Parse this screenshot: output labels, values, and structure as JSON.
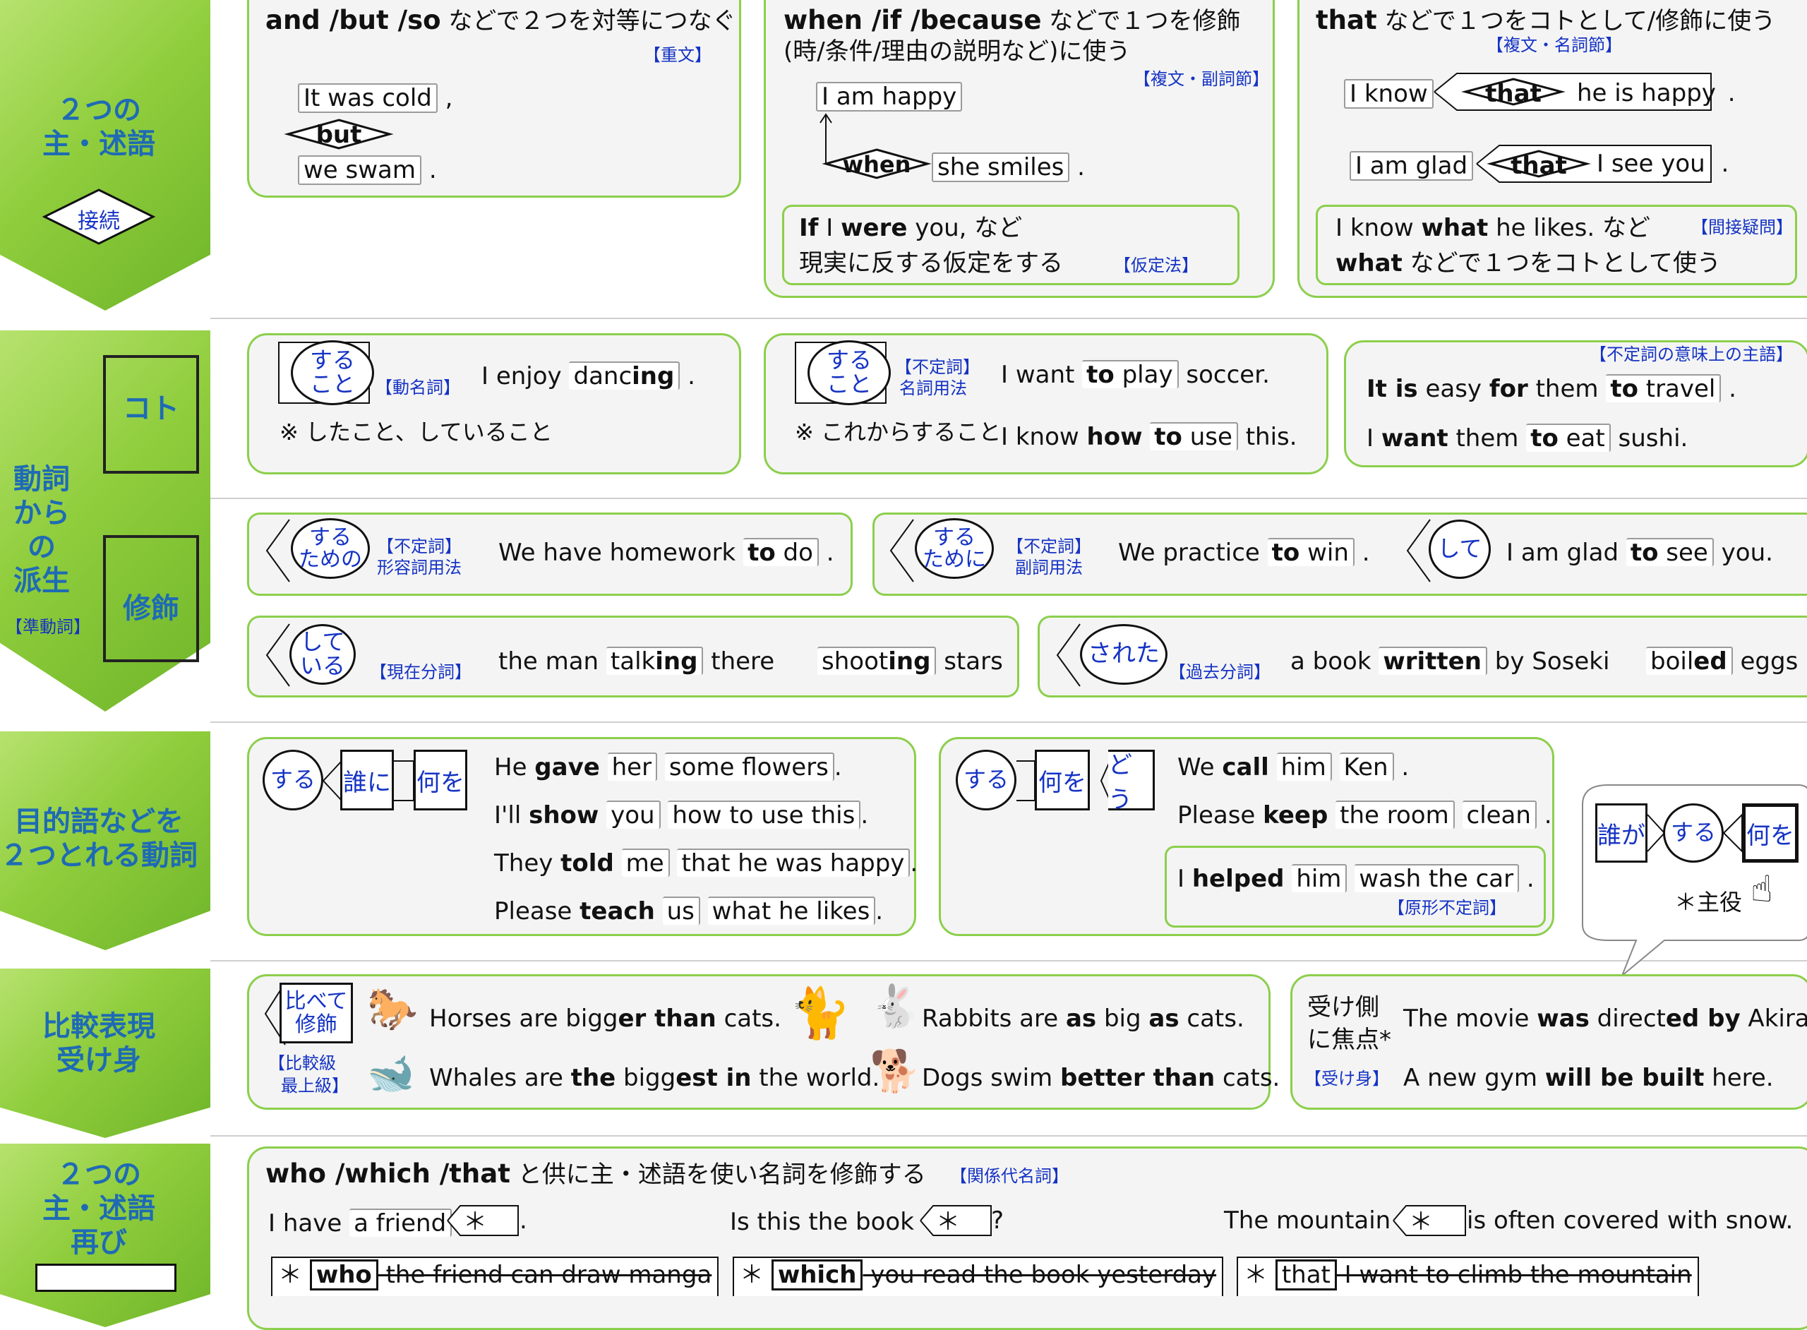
{
  "side": {
    "s1": {
      "line1": "２つの",
      "line2": "主・述語",
      "tag": "接続"
    },
    "s2": {
      "line1": "動詞",
      "line2": "からの",
      "line3": "派生",
      "tag": "【準動詞】",
      "koto": "コト",
      "shushoku": "修飾"
    },
    "s3": {
      "line1": "目的語などを",
      "line2": "２つとれる動詞"
    },
    "s4": {
      "line1": "比較表現",
      "line2": "受け身"
    },
    "s5": {
      "line1": "２つの",
      "line2": "主・述語",
      "line3": "再び"
    }
  },
  "r1": {
    "a": {
      "head_b": "and /but /so",
      "head_t": " などで２つを対等につなぐ",
      "tag": "【重文】",
      "l1": "It was cold",
      "l1_end": " ,",
      "conj": "but",
      "l2": "we swam",
      "l2_end": " ."
    },
    "b": {
      "head_b": "when /if /because",
      "head_t": " などで１つを修飾",
      "head2": "(時/条件/理由の説明など)に使う",
      "tag": "【複文・副詞節】",
      "main": "I am happy",
      "conj": "when",
      "sub": "she smiles",
      "sub_end": " .",
      "inner_b1": "If",
      "inner_t1": " I ",
      "inner_b2": "were",
      "inner_t2": " you, など",
      "inner_l2": "現実に反する仮定をする",
      "inner_tag": "【仮定法】"
    },
    "c": {
      "head_b": "that",
      "head_t": " などで１つをコトとして/修飾に使う",
      "tag": "【複文・名詞節】",
      "l1a": "I know",
      "l1k": "that",
      "l1b": "he is happy",
      "l1_end": " .",
      "l2a": "I am glad",
      "l2k": "that",
      "l2b": "I see you",
      "l2_end": " .",
      "inner_t1": "I know ",
      "inner_b1": "what",
      "inner_t2": " he likes. など",
      "inner_tag": "【間接疑問】",
      "inner_b2": "what",
      "inner_t3": " などで１つをコトとして使う"
    }
  },
  "r2": {
    "a": {
      "circ": "する\nこと",
      "tag": "【動名詞】",
      "s_pre": "I enjoy ",
      "s_w1": "danc",
      "s_w2": "ing",
      "s_end": " .",
      "note": "※ したこと、していること"
    },
    "b": {
      "circ": "する\nこと",
      "tag1": "【不定詞】",
      "tag2": "名詞用法",
      "s1_pre": "I want ",
      "s1_b": "to",
      "s1_w": " play",
      "s1_end": " soccer.",
      "note": "※ これからすること",
      "s2_pre": "I know ",
      "s2_b1": "how",
      "s2_b2": "to",
      "s2_w": " use",
      "s2_end": " this."
    },
    "c": {
      "tag": "【不定詞の意味上の主語】",
      "l1_b1": "It is",
      "l1_t1": " easy ",
      "l1_b2": "for",
      "l1_t2": " them ",
      "l1_b3": "to",
      "l1_w": " travel",
      "l1_end": " .",
      "l2_t1": "I ",
      "l2_b1": "want",
      "l2_t2": " them ",
      "l2_b2": "to",
      "l2_w": " eat",
      "l2_end": " sushi."
    }
  },
  "r3": {
    "a": {
      "circ": "する\nための",
      "tag1": "【不定詞】",
      "tag2": "形容詞用法",
      "s_pre": "We have homework ",
      "s_b": "to",
      "s_w": " do",
      "s_end": " ."
    },
    "b": {
      "circ": "する\nために",
      "tag1": "【不定詞】",
      "tag2": "副詞用法",
      "s_pre": "We practice ",
      "s_b": "to",
      "s_w": " win",
      "s_end": " .",
      "circ2": "して",
      "s2_pre": "I am glad ",
      "s2_b": "to",
      "s2_w": " see",
      "s2_end": " you."
    }
  },
  "r4": {
    "a": {
      "circ": "して\nいる",
      "tag": "【現在分詞】",
      "s_pre": "the man ",
      "s_w1": "talk",
      "s_w2": "ing",
      "s_end": " there",
      "s2_w1": "shoot",
      "s2_w2": "ing",
      "s2_end": " stars"
    },
    "b": {
      "circ": "された",
      "tag": "【過去分詞】",
      "s_pre": "a book ",
      "s_w": "written",
      "s_end": " by Soseki",
      "s2_w1": "boil",
      "s2_w2": "ed",
      "s2_end": " eggs"
    }
  },
  "r5": {
    "a": {
      "circ": "する",
      "sq1": "誰に",
      "sq2": "何を",
      "l1_t1": "He ",
      "l1_b": "gave",
      "l1_w1": "her",
      "l1_w2": "some flowers",
      "l1_end": ".",
      "l2_t1": "I'll ",
      "l2_b": "show",
      "l2_w1": "you",
      "l2_w2": "how to use this",
      "l2_end": ".",
      "l3_t1": "They ",
      "l3_b": "told",
      "l3_w1": "me",
      "l3_w2": "that he was happy",
      "l3_end": ".",
      "l4_t1": "Please ",
      "l4_b": "teach",
      "l4_w1": "us",
      "l4_w2": "what he likes",
      "l4_end": "."
    },
    "b": {
      "circ": "する",
      "sq1": "何を",
      "sq2": "どう",
      "l1_t1": "We ",
      "l1_b": "call",
      "l1_w1": "him",
      "l1_w2": "Ken",
      "l1_end": " .",
      "l2_t1": "Please ",
      "l2_b": "keep",
      "l2_w1": "the room",
      "l2_w2": "clean",
      "l2_end": " .",
      "in_t1": "I ",
      "in_b": "helped",
      "in_w1": "him",
      "in_w2": "wash the car",
      "in_end": " .",
      "in_tag": "【原形不定詞】"
    },
    "c": {
      "sq1": "誰が",
      "circ": "する",
      "sq2": "何を",
      "note": "＊主役"
    }
  },
  "r6": {
    "a": {
      "circ": "比べて\n修飾",
      "tag1": "【比較級",
      "tag2": "最上級】",
      "l1_t1": "Horses are bigg",
      "l1_b1": "er than",
      "l1_t2": " cats.",
      "l2_t1": "Whales are ",
      "l2_b1": "the",
      "l2_t2": " bigg",
      "l2_b2": "est in",
      "l2_t3": " the world.",
      "l3_t1": "Rabbits are ",
      "l3_b1": "as",
      "l3_t2": " big ",
      "l3_b2": "as",
      "l3_t3": " cats.",
      "l4_t1": "Dogs swim ",
      "l4_b1": "better than",
      "l4_t2": " cats."
    },
    "b": {
      "label1": "受け側",
      "label2": "に焦点*",
      "tag": "【受け身】",
      "l1_t1": "The movie ",
      "l1_b1": "was",
      "l1_t2": " direct",
      "l1_b2": "ed by",
      "l1_t3": " Akira.",
      "l2_t1": "A new gym ",
      "l2_b1": "will be built",
      "l2_t2": " here."
    }
  },
  "r7": {
    "head_b": "who /which /that",
    "head_t": " と供に主・述語を使い名詞を修飾する",
    "tag": "【関係代名詞】",
    "a": {
      "pre": "I have ",
      "w": "a friend",
      "slot": "＊",
      "end": " .",
      "k": "who",
      "rest": " the friend can draw manga"
    },
    "b": {
      "pre": "Is this the book",
      "slot": "＊",
      "end": " ?",
      "k": "which",
      "rest": " you read the book yesterday"
    },
    "c": {
      "pre": "The mountain",
      "slot": "＊",
      "end": " is often covered with snow.",
      "k": "that",
      "rest": " I want to climb the mountain"
    }
  }
}
